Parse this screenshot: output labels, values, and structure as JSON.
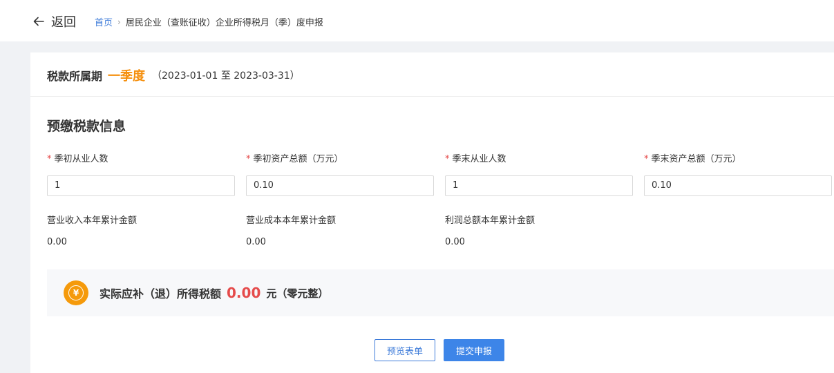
{
  "header": {
    "back_label": "返回",
    "breadcrumb": {
      "home": "首页",
      "separator": "›",
      "current": "居民企业（查账征收）企业所得税月（季）度申报"
    }
  },
  "period": {
    "label": "税款所属期",
    "value": "一季度",
    "range": "（2023-01-01 至 2023-03-31）"
  },
  "section": {
    "title": "预缴税款信息"
  },
  "fields": [
    {
      "label": "季初从业人数",
      "value": "1",
      "required": "*"
    },
    {
      "label": "季初资产总额（万元）",
      "value": "0.10",
      "required": "*"
    },
    {
      "label": "季末从业人数",
      "value": "1",
      "required": "*"
    },
    {
      "label": "季末资产总额（万元）",
      "value": "0.10",
      "required": "*"
    }
  ],
  "readonly": [
    {
      "label": "营业收入本年累计金额",
      "value": "0.00"
    },
    {
      "label": "营业成本本年累计金额",
      "value": "0.00"
    },
    {
      "label": "利润总额本年累计金额",
      "value": "0.00"
    }
  ],
  "summary": {
    "label": "实际应补（退）所得税额",
    "amount": "0.00",
    "unit": "元（零元整）",
    "icon_glyph": "¥"
  },
  "buttons": {
    "preview": "预览表单",
    "submit": "提交申报"
  },
  "colors": {
    "accent": "#3d7bd9",
    "period": "#f58f0d",
    "amount": "#e54b4b",
    "coin": "#f59a0b"
  }
}
